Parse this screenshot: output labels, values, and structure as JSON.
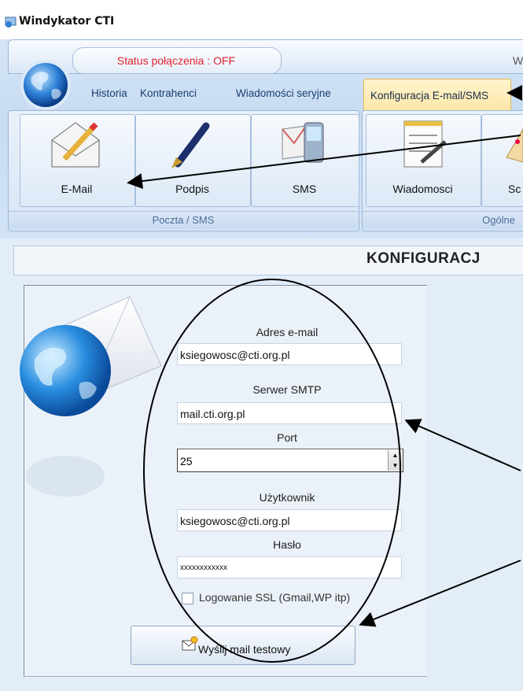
{
  "window": {
    "title": "Windykator CTI"
  },
  "status": {
    "connection": "Status połączenia : OFF",
    "corner_text": "W"
  },
  "tabs": [
    "Historia",
    "Kontrahenci",
    "Wiadomości seryjne",
    "Konfiguracja E-mail/SMS"
  ],
  "ribbon": {
    "groups": [
      {
        "label": "Poczta / SMS",
        "buttons": [
          "E-Mail",
          "Podpis",
          "SMS"
        ]
      },
      {
        "label": "Ogólne",
        "buttons": [
          "Wiadomosci",
          "Sc"
        ]
      }
    ]
  },
  "main": {
    "header": "KONFIGURACJ",
    "form": {
      "email_label": "Adres e-mail",
      "email_value": "ksiegowosc@cti.org.pl",
      "smtp_label": "Serwer SMTP",
      "smtp_value": "mail.cti.org.pl",
      "port_label": "Port",
      "port_value": "25",
      "user_label": "Użytkownik",
      "user_value": "ksiegowosc@cti.org.pl",
      "password_label": "Hasło",
      "password_value": "xxxxxxxxxxxx",
      "ssl_label": "Logowanie SSL (Gmail,WP itp)",
      "test_button": "Wyślij mail testowy"
    }
  },
  "colors": {
    "status_off": "#e3232d",
    "ribbon_bg": "#d6e6f7",
    "active_tab": "#fde7a6"
  }
}
